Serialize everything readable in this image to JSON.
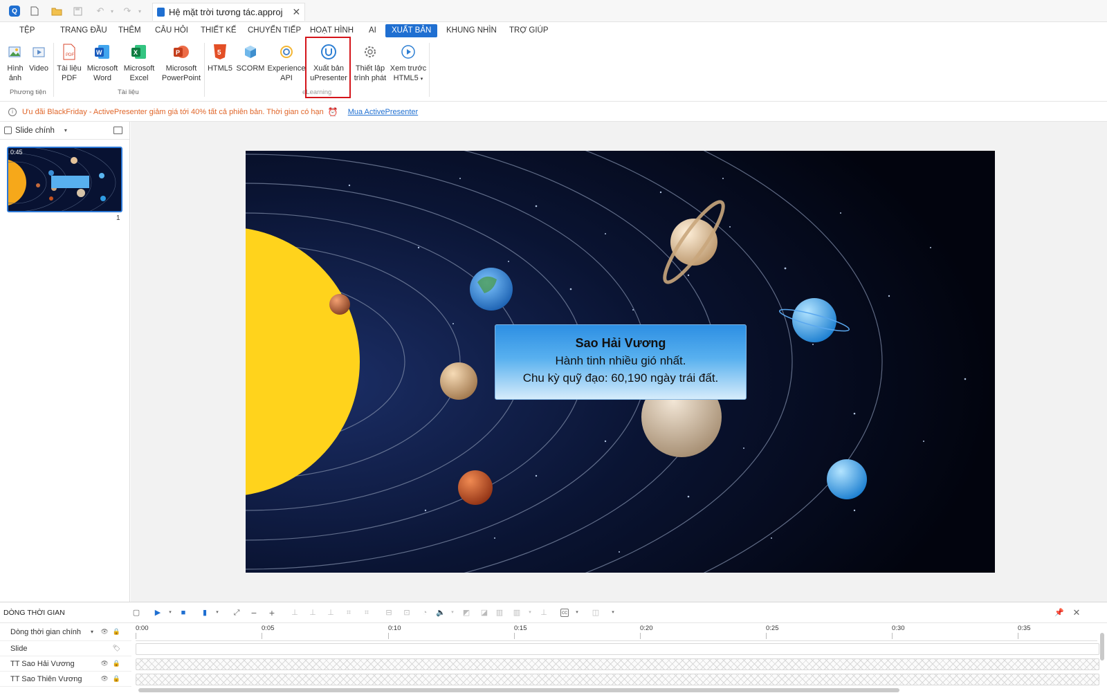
{
  "titlebar": {
    "app_logo": "Q",
    "document_title": "Hệ mặt trời tương tác.approj",
    "close_glyph": "✕"
  },
  "menu": {
    "tabs": [
      "TỆP",
      "TRANG ĐẦU",
      "THÊM",
      "CÂU HỎI",
      "THIẾT KẾ",
      "CHUYỂN TIẾP",
      "HOẠT HÌNH",
      "AI",
      "XUẤT BẢN",
      "KHUNG NHÌN",
      "TRỢ GIÚP"
    ],
    "active": "XUẤT BẢN"
  },
  "ribbon": {
    "buttons": {
      "image": "Hình\nảnh",
      "video": "Video",
      "pdf": "Tài liệu\nPDF",
      "word": "Microsoft\nWord",
      "excel": "Microsoft\nExcel",
      "powerpoint": "Microsoft\nPowerPoint",
      "html5": "HTML5",
      "scorm": "SCORM",
      "xapi": "Experience\nAPI",
      "upresenter": "Xuất bản\nuPresenter",
      "player_settings": "Thiết lập\ntrình phát",
      "preview_html5": "Xem trước\nHTML5"
    },
    "groups": {
      "media": "Phương tiện",
      "documents": "Tài liệu",
      "elearning": "eLearning"
    }
  },
  "notification": {
    "message": "Ưu đãi BlackFriday - ActivePresenter giảm giá tới 40% tất cả phiên bản. Thời gian có hạn",
    "link": "Mua ActivePresenter"
  },
  "slide_panel": {
    "selector_label": "Slide chính",
    "thumbnail_duration": "0:45",
    "slide_number": "1"
  },
  "stage": {
    "info_title": "Sao Hải Vương",
    "info_line1": "Hành tinh nhiều gió nhất.",
    "info_line2": "Chu kỳ quỹ đạo: 60,190 ngày trái đất."
  },
  "timeline": {
    "title": "DÒNG THỜI GIAN",
    "timeline_selector": "Dòng thời gian chính",
    "rows": [
      "Slide",
      "TT Sao Hải Vương",
      "TT Sao Thiên Vương"
    ],
    "ruler_ticks": [
      "0:00",
      "0:05",
      "0:10",
      "0:15",
      "0:20",
      "0:25",
      "0:30",
      "0:35"
    ]
  },
  "colors": {
    "accent": "#1f6fd1",
    "highlight_box": "#d4141a",
    "notification_text": "#e0662a"
  }
}
